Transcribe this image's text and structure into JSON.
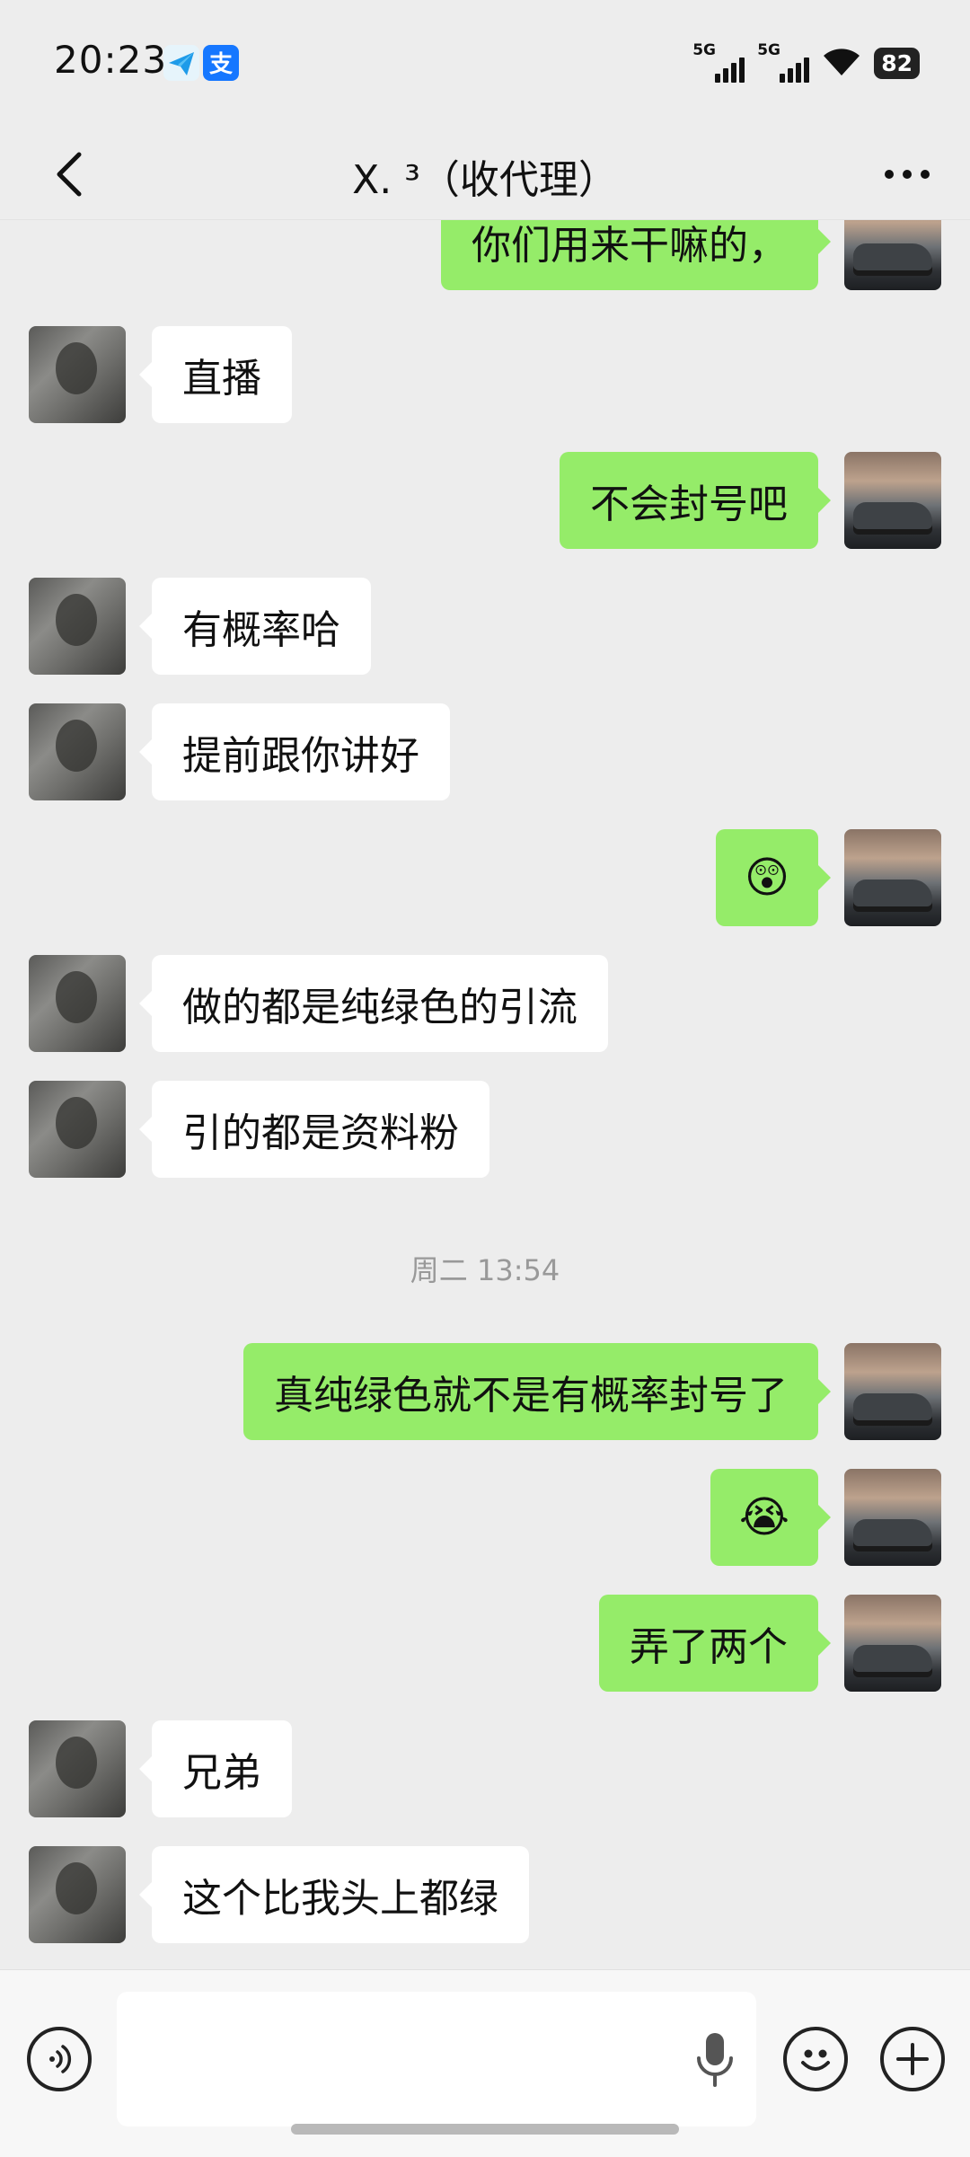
{
  "status_bar": {
    "time": "20:23",
    "signal_1": "5G",
    "signal_2": "5G",
    "battery": "82"
  },
  "nav": {
    "title": "X. ³（收代理）"
  },
  "messages": [
    {
      "side": "mine",
      "text": "你们用来干嘛的，"
    },
    {
      "side": "other",
      "text": "直播"
    },
    {
      "side": "mine",
      "text": "不会封号吧"
    },
    {
      "side": "other",
      "text": "有概率哈"
    },
    {
      "side": "other",
      "text": "提前跟你讲好"
    },
    {
      "side": "mine",
      "emoji": "😲"
    },
    {
      "side": "other",
      "text": "做的都是纯绿色的引流"
    },
    {
      "side": "other",
      "text": "引的都是资料粉"
    },
    {
      "side": "mine",
      "text": "真纯绿色就不是有概率封号了"
    },
    {
      "side": "mine",
      "emoji": "😭"
    },
    {
      "side": "mine",
      "text": "弄了两个"
    },
    {
      "side": "other",
      "text": "兄弟"
    },
    {
      "side": "other",
      "text": "这个比我头上都绿"
    }
  ],
  "timestamp": "周二 13:54",
  "input": {
    "placeholder": ""
  },
  "colors": {
    "background": "#ededed",
    "my_bubble": "#95ec69",
    "other_bubble": "#ffffff"
  }
}
